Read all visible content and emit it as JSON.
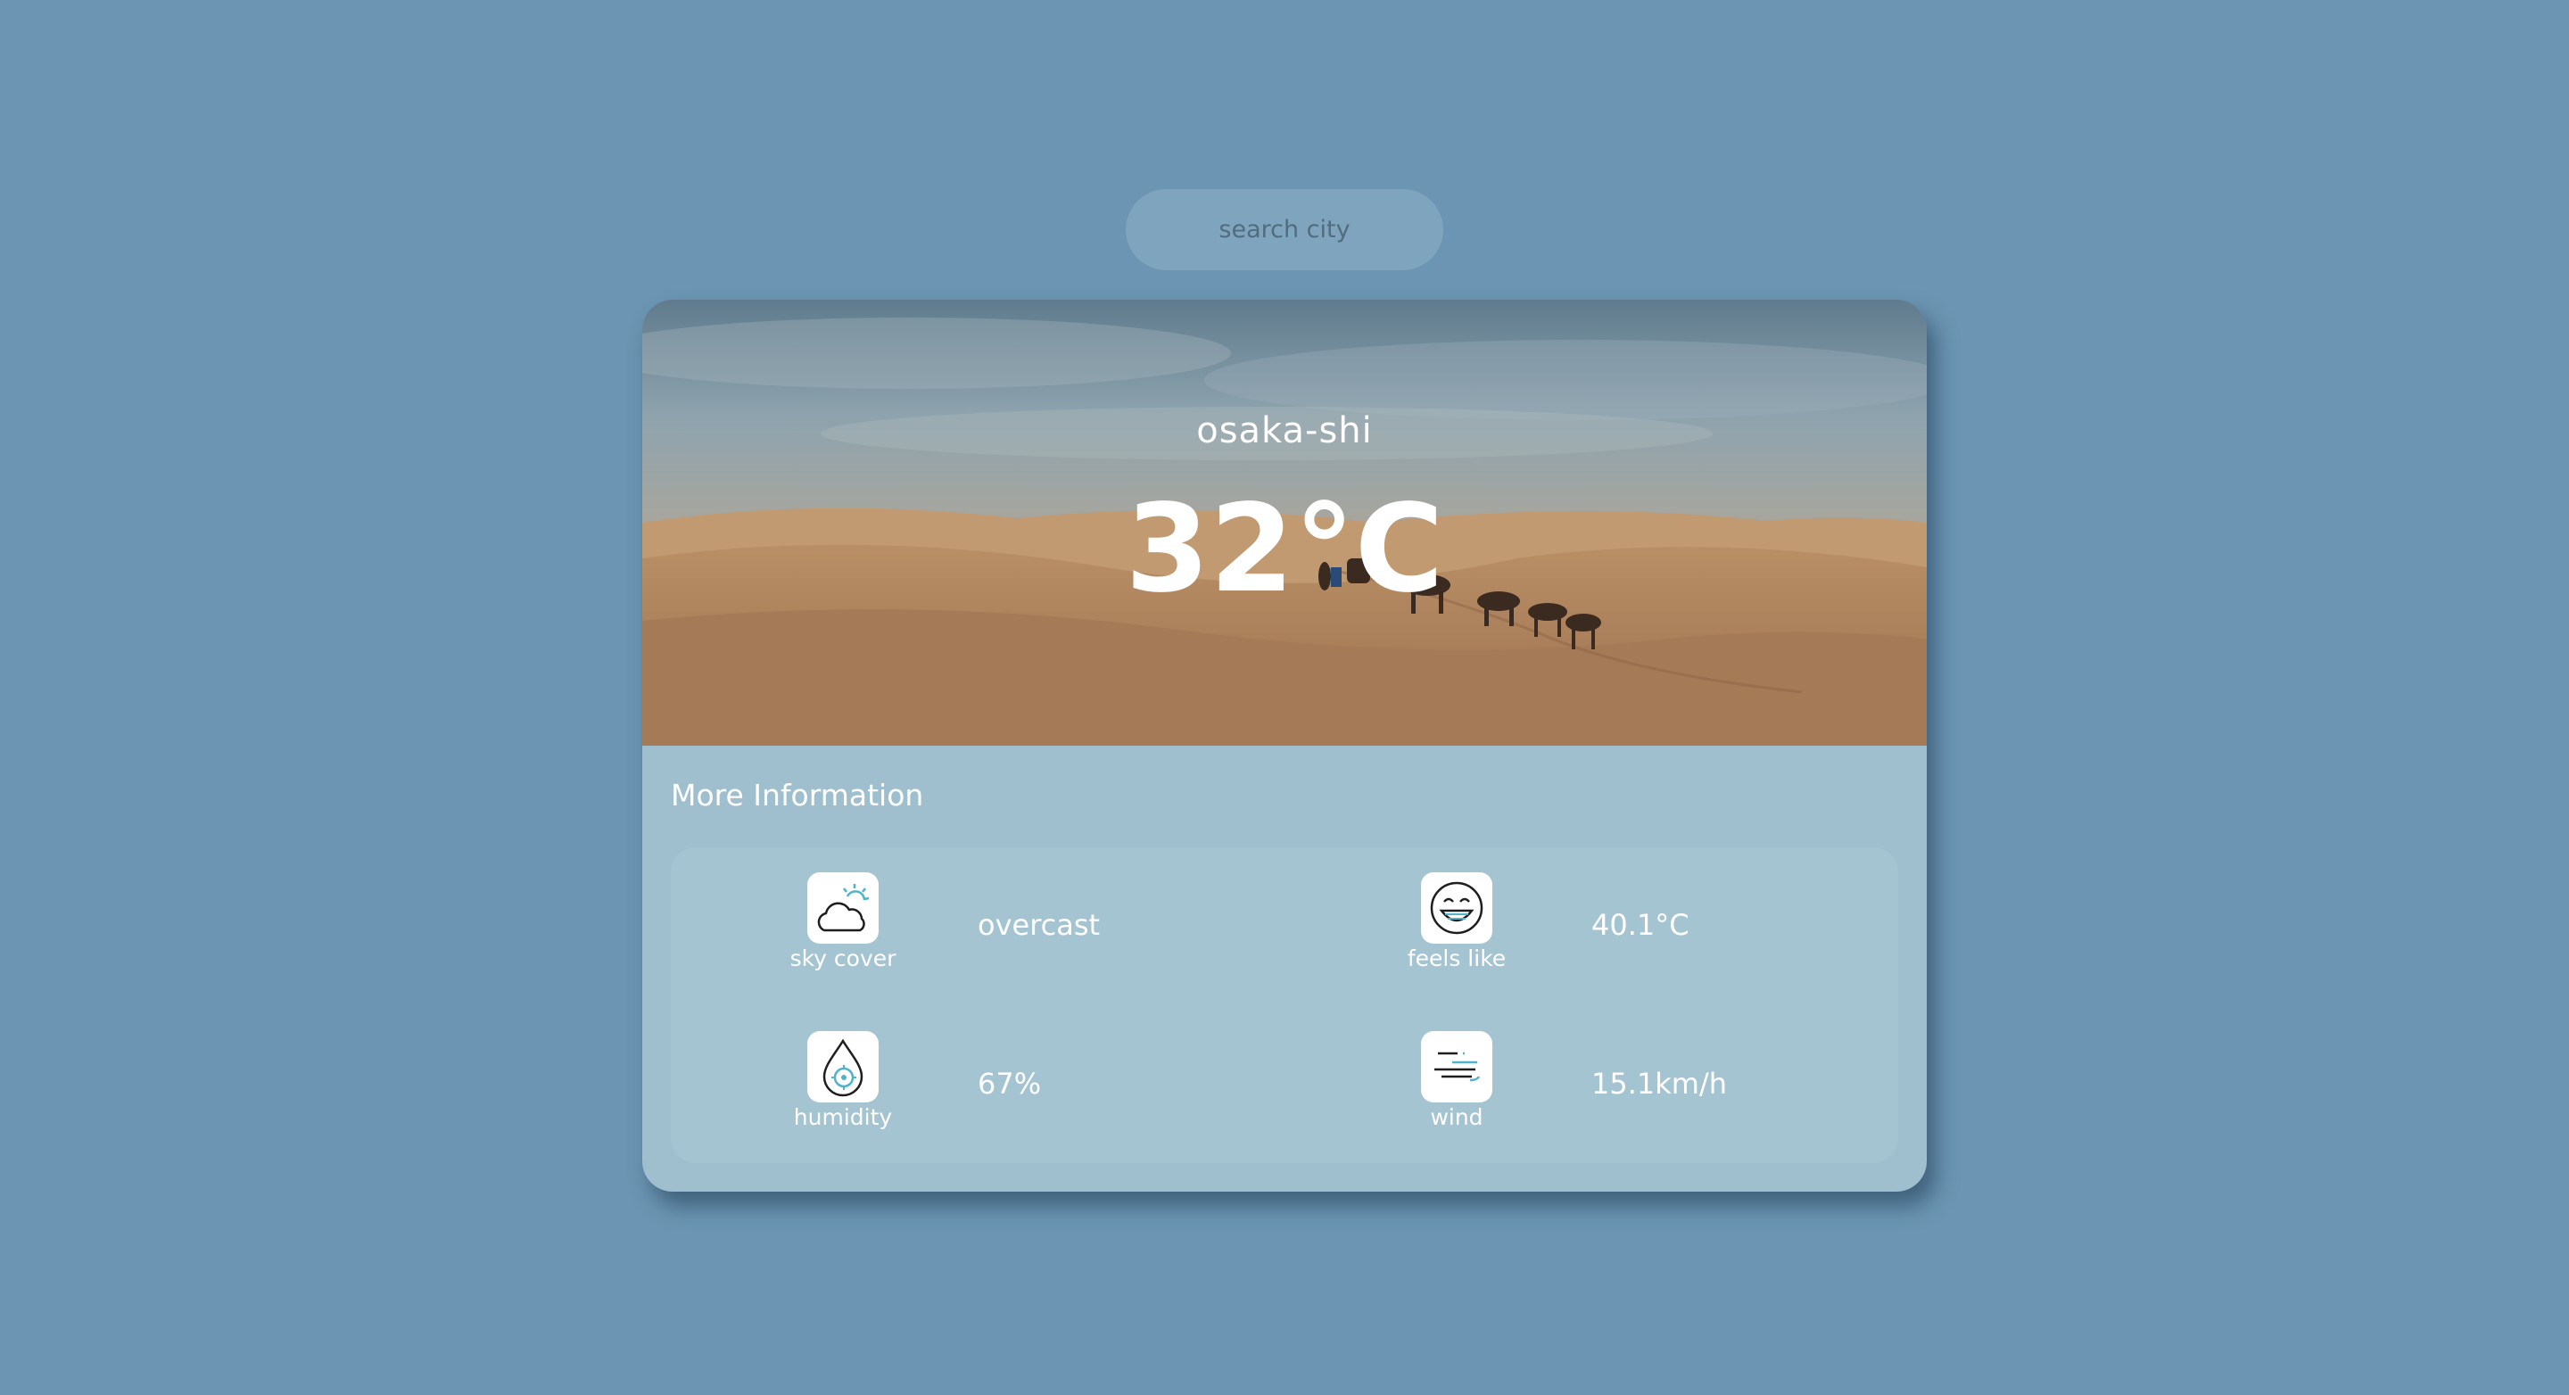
{
  "search": {
    "placeholder": "search city"
  },
  "weather": {
    "city": "osaka-shi",
    "temperature": "32°C"
  },
  "more_info": {
    "title": "More Information",
    "items": [
      {
        "label": "sky cover",
        "value": "overcast",
        "icon": "cloud-sun-icon"
      },
      {
        "label": "feels like",
        "value": "40.1°C",
        "icon": "smiley-face-icon"
      },
      {
        "label": "humidity",
        "value": "67%",
        "icon": "water-drop-icon"
      },
      {
        "label": "wind",
        "value": "15.1km/h",
        "icon": "wind-icon"
      }
    ]
  },
  "colors": {
    "background": "#6b95b2",
    "card": "#9fbfcf",
    "panel": "#a5c4d1",
    "icon_accent": "#4fb3cc"
  }
}
